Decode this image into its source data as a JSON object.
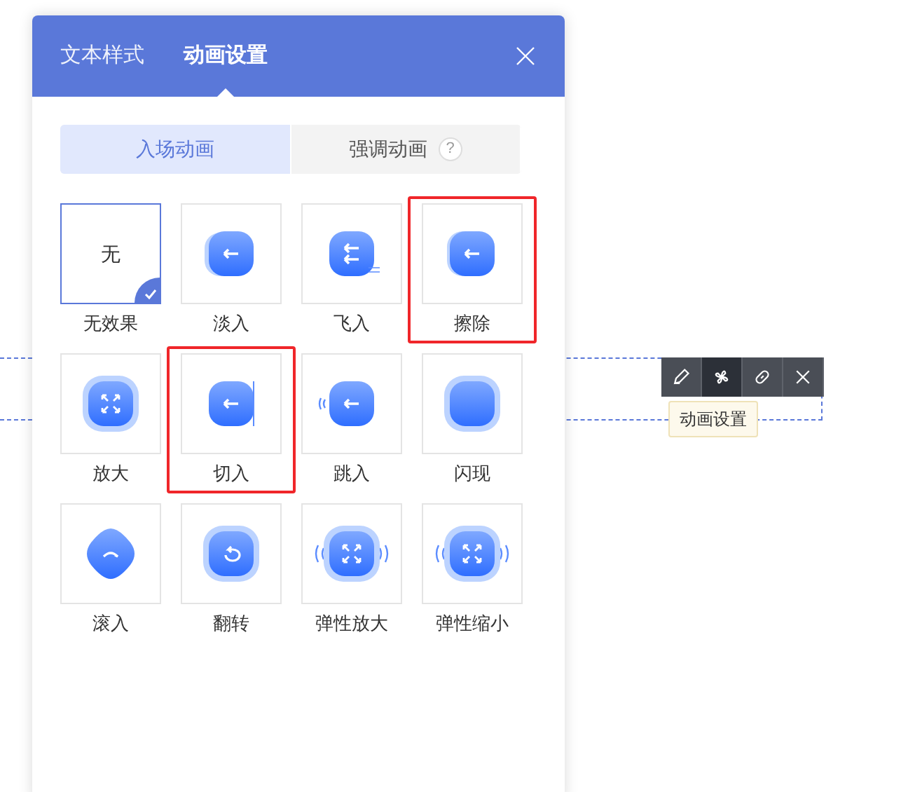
{
  "panel": {
    "tabs": [
      {
        "label": "文本样式",
        "selected": false
      },
      {
        "label": "动画设置",
        "selected": true
      }
    ],
    "segments": [
      {
        "label": "入场动画",
        "selected": true,
        "help": false
      },
      {
        "label": "强调动画",
        "selected": false,
        "help": true
      }
    ],
    "help_mark": "?",
    "effects": [
      {
        "kind": "none",
        "glyph": "无",
        "label": "无效果",
        "selected": true,
        "highlighted": false
      },
      {
        "kind": "fade",
        "label": "淡入",
        "selected": false,
        "highlighted": false
      },
      {
        "kind": "fly",
        "label": "飞入",
        "selected": false,
        "highlighted": false
      },
      {
        "kind": "wipe",
        "label": "擦除",
        "selected": false,
        "highlighted": true
      },
      {
        "kind": "zoom",
        "label": "放大",
        "selected": false,
        "highlighted": false
      },
      {
        "kind": "cut",
        "label": "切入",
        "selected": false,
        "highlighted": true
      },
      {
        "kind": "bounce",
        "label": "跳入",
        "selected": false,
        "highlighted": false
      },
      {
        "kind": "flash",
        "label": "闪现",
        "selected": false,
        "highlighted": false
      },
      {
        "kind": "roll",
        "label": "滚入",
        "selected": false,
        "highlighted": false
      },
      {
        "kind": "flip",
        "label": "翻转",
        "selected": false,
        "highlighted": false
      },
      {
        "kind": "elastic-zoom",
        "label": "弹性放大",
        "selected": false,
        "highlighted": false
      },
      {
        "kind": "elastic-shrink",
        "label": "弹性缩小",
        "selected": false,
        "highlighted": false
      }
    ]
  },
  "toolbar": {
    "buttons": [
      {
        "kind": "edit",
        "selected": false
      },
      {
        "kind": "animation",
        "selected": true
      },
      {
        "kind": "link",
        "selected": false
      },
      {
        "kind": "close",
        "selected": false
      }
    ],
    "tooltip": "动画设置"
  }
}
